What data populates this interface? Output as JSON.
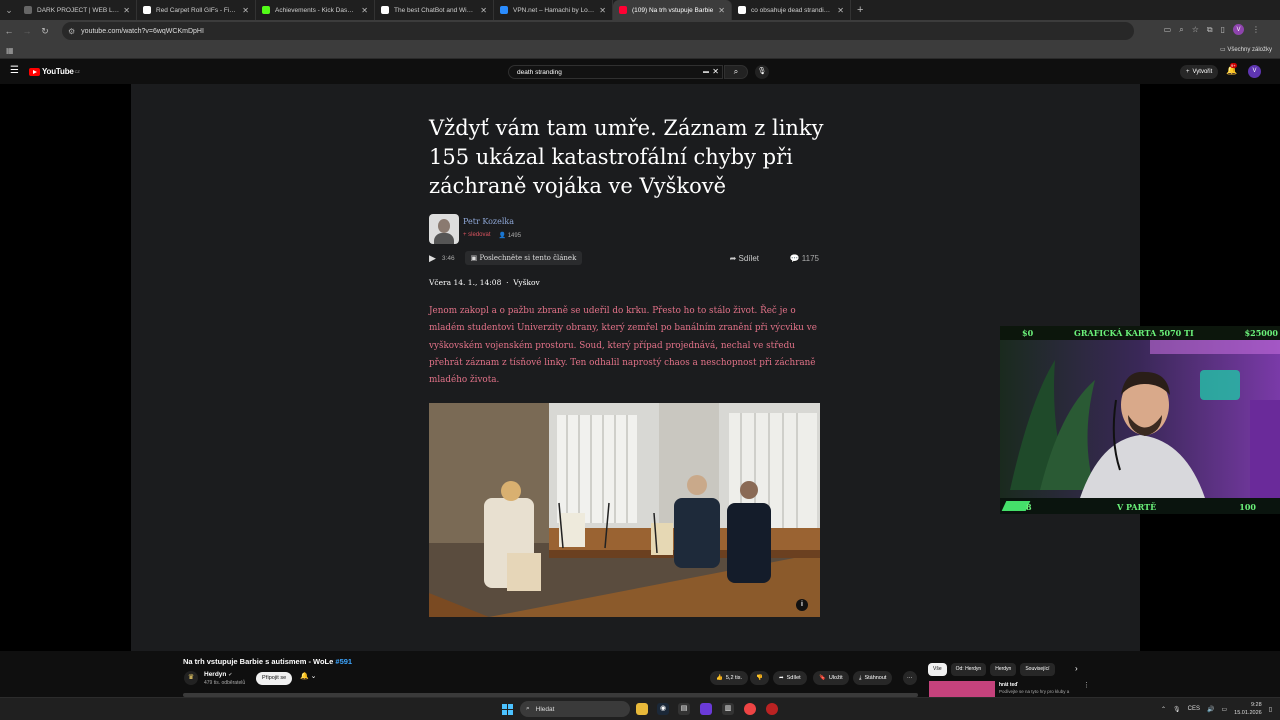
{
  "browser": {
    "tabs": [
      {
        "title": "DARK PROJECT | WEB LAB",
        "color": "#666666"
      },
      {
        "title": "Red Carpet Roll GIFs - Find & Share",
        "color": "#ffffff"
      },
      {
        "title": "Achievements - Kick Dashboard",
        "color": "#53fc18"
      },
      {
        "title": "The best ChatBot and Widgets",
        "color": "#ffffff"
      },
      {
        "title": "VPN.net – Hamachi by LogMeIn",
        "color": "#2a8cff"
      },
      {
        "title": "(109) Na trh vstupuje Barbie",
        "color": "#ff0033",
        "active": true
      },
      {
        "title": "co obsahuje dead stranding co",
        "color": "#ffffff"
      }
    ],
    "url": "youtube.com/watch?v=6wqWCKmDpHI",
    "bookmarks_all": "Všechny záložky"
  },
  "youtube": {
    "logo": "YouTube",
    "region": "CZ",
    "search_value": "death stranding",
    "create_label": "Vytvořit",
    "bell_badge": "9+",
    "avatar_letter": "V"
  },
  "article": {
    "title": "Vždyť vám tam umře. Záznam z linky 155 ukázal katastrofální chyby při záchraně vojáka ve Vyškově",
    "author": "Petr Kozelka",
    "follow": "+ sledovat",
    "followers": "1495",
    "audio_duration": "3:46",
    "listen_label": "Poslechněte si tento článek",
    "share_label": "Sdílet",
    "comments": "1175",
    "date": "Včera 14. 1., 14:08",
    "place": "Vyškov",
    "perex": "Jenom zakopl a o pažbu zbraně se udeřil do krku. Přesto ho to stálo život. Řeč je o mladém studentovi Univerzity obrany, který zemřel po banálním zranění při výcviku ve vyškovském vojenském prostoru. Soud, který případ projednává, nechal ve středu přehrát záznam z tísňové linky. Ten odhalil naprostý chaos a neschopnost při záchraně mladého života."
  },
  "overlay": {
    "left_value": "$0",
    "goal_title": "GRAFICKÁ KARTA 5070 TI",
    "right_value": "$25000",
    "bottom_left": "8",
    "bottom_title": "V PARTĚ",
    "bottom_right": "100"
  },
  "video": {
    "title": "Na trh vstupuje Barbie s autismem - WoLe",
    "hashtag": "#591",
    "channel": "Herdyn",
    "subs": "479 tis. odběratelů",
    "join_label": "Připojit se",
    "likes": "5,2 tis.",
    "share": "Sdílet",
    "save": "Uložit",
    "download": "Stáhnout"
  },
  "sidebar": {
    "chips": [
      "Vše",
      "Od: Herdyn",
      "Herdyn",
      "Související"
    ],
    "rec_title": "hrát teď",
    "rec_sub": "Podívejte se na tyto hry pro kluby a"
  },
  "taskbar": {
    "search": "Hledat",
    "lang": "CES",
    "time": "9:28",
    "date": "15.01.2026"
  }
}
